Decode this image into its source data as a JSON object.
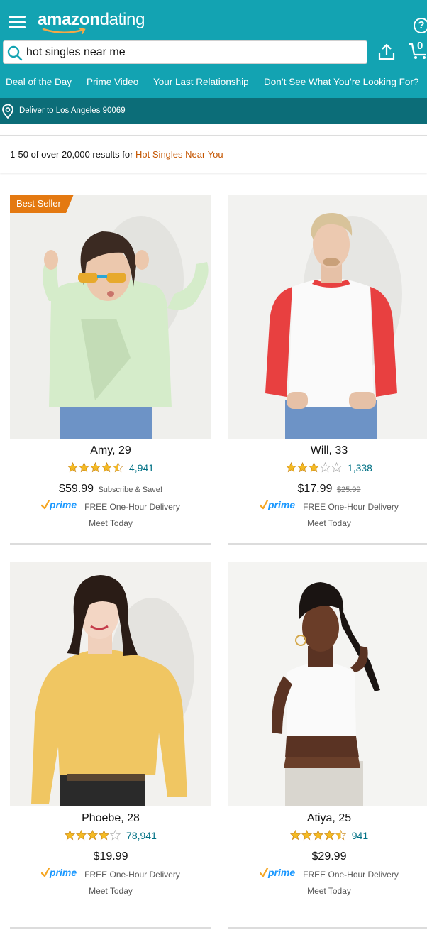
{
  "header": {
    "brand_bold": "amazon",
    "brand_light": "dating",
    "help_glyph": "?",
    "cart_count": "0",
    "brand_color": "#13a3b2",
    "deliver_bar_color": "#0c6d78"
  },
  "search": {
    "value": "hot singles near me"
  },
  "nav": {
    "items": [
      "Deal of the Day",
      "Prime Video",
      "Your Last Relationship",
      "Don’t See What You’re Looking For?"
    ]
  },
  "delivery": {
    "text": "Deliver to Los Angeles 90069"
  },
  "results": {
    "prefix": "1-50 of over 20,000 results for ",
    "query": "Hot Singles Near You"
  },
  "products": [
    {
      "badge": "Best Seller",
      "name": "Amy, 29",
      "rating": 4.5,
      "reviews": "4,941",
      "price": "$59.99",
      "price_note": "Subscribe & Save!",
      "prime": "prime",
      "delivery": "FREE One-Hour Delivery",
      "meet": "Meet Today",
      "photo_icon": "person-photo-green-top"
    },
    {
      "name": "Will, 33",
      "rating": 3,
      "reviews": "1,338",
      "price": "$17.99",
      "list_price": "$25.99",
      "prime": "prime",
      "delivery": "FREE One-Hour Delivery",
      "meet": "Meet Today",
      "photo_icon": "person-photo-raglan-shirt"
    },
    {
      "name": "Phoebe, 28",
      "rating": 4,
      "reviews": "78,941",
      "price": "$19.99",
      "prime": "prime",
      "delivery": "FREE One-Hour Delivery",
      "meet": "Meet Today",
      "photo_icon": "person-photo-yellow-sweater"
    },
    {
      "name": "Atiya, 25",
      "rating": 4.5,
      "reviews": "941",
      "price": "$29.99",
      "prime": "prime",
      "delivery": "FREE One-Hour Delivery",
      "meet": "Meet Today",
      "photo_icon": "person-photo-white-crop-top"
    }
  ]
}
